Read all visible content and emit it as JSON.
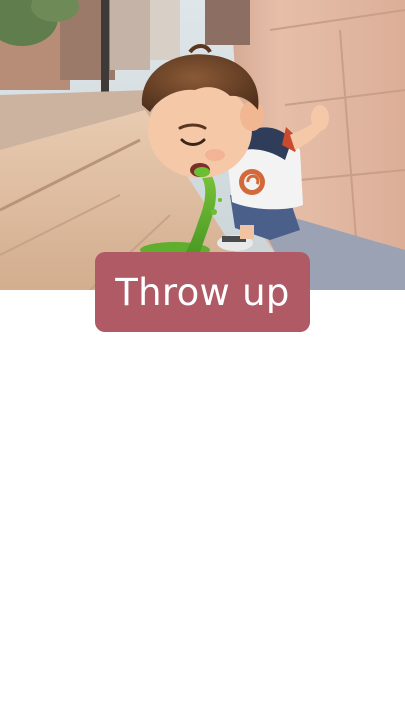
{
  "caption": {
    "text": "Throw up",
    "background_color": "#b05a66",
    "text_color": "#ffffff"
  },
  "illustration": {
    "subject": "boy-vomiting-against-wall",
    "colors": {
      "wall": "#e2b9a3",
      "sidewalk": "#d9b79a",
      "street": "#c9a98c",
      "hair": "#6b4329",
      "skin": "#f5c8a8",
      "shirt": "#f3f3f3",
      "sleeve": "#2f3d5a",
      "shorts": "#4a5f8a",
      "vomit": "#5fae2e",
      "logo": "#d2693a"
    }
  }
}
